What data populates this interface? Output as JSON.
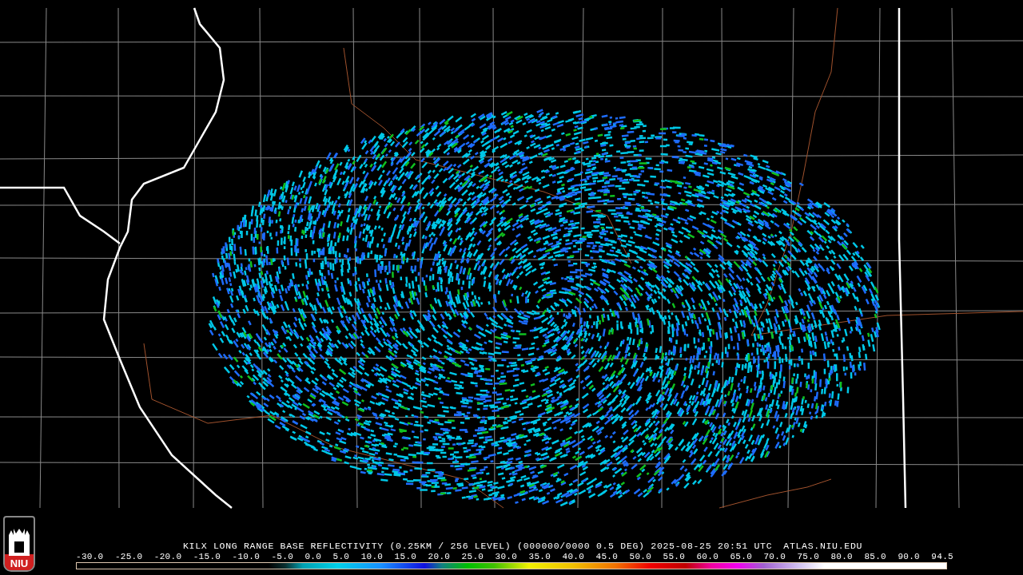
{
  "map": {
    "product_title": "KILX LONG RANGE BASE REFLECTIVITY (0.25KM / 256 LEVEL) (000000/0000 0.5 DEG) 2025-08-25 20:51 UTC",
    "site": "ATLAS.NIU.EDU"
  },
  "logo": {
    "text": "NIU"
  },
  "legend": {
    "ticks": [
      "-30.0",
      "-25.0",
      "-20.0",
      "-15.0",
      "-10.0",
      "-5.0",
      "0.0",
      "5.0",
      "10.0",
      "15.0",
      "20.0",
      "25.0",
      "30.0",
      "35.0",
      "40.0",
      "45.0",
      "50.0",
      "55.0",
      "60.0",
      "65.0",
      "70.0",
      "75.0",
      "80.0",
      "85.0",
      "90.0",
      "94.5"
    ]
  }
}
